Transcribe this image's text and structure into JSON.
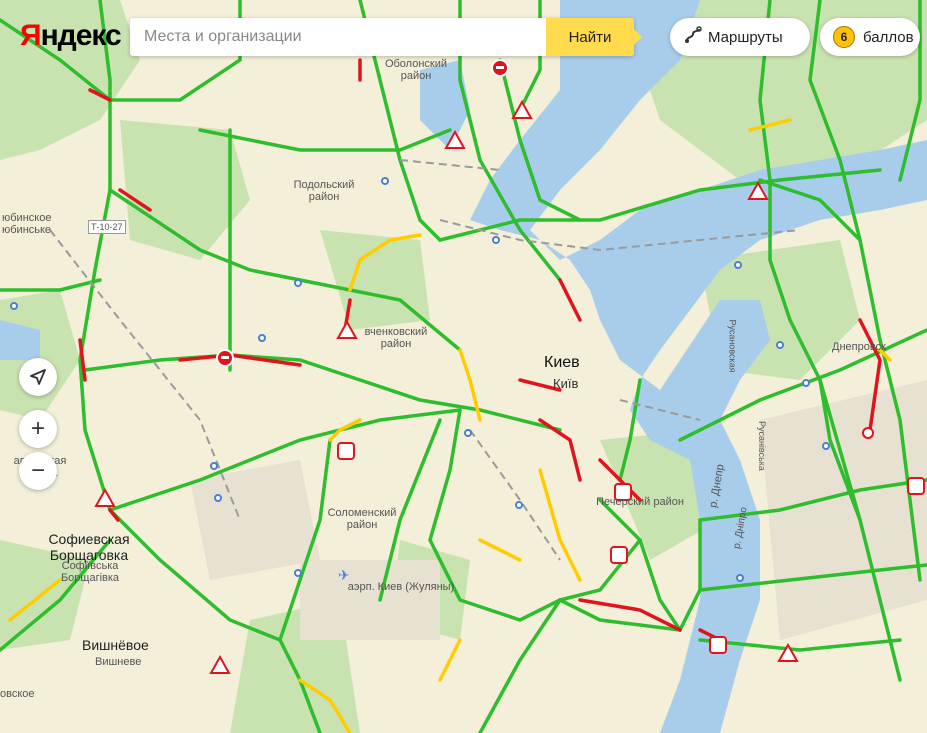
{
  "logo": {
    "part1": "Я",
    "part2": "ндекс"
  },
  "search": {
    "placeholder": "Места и организации",
    "button": "Найти"
  },
  "routes": {
    "label": "Маршруты"
  },
  "points": {
    "count": "6",
    "label": "баллов"
  },
  "controls": {
    "locate": "➤",
    "zoom_in": "+",
    "zoom_out": "−"
  },
  "labels": {
    "obolon": "Оболонский район",
    "podil": "Подольский район",
    "shevchenko": "вченковский район",
    "kyiv_ru": "Киев",
    "kyiv_ua": "Київ",
    "pechersk": "Печерский район",
    "solomyansky": "Соломенский район",
    "airport": "аэрп. Киев (Жуляны)",
    "sofievska": "Софиевская Борщаговка",
    "sofiivska": "Софіївська Борщагівка",
    "vishneve": "Вишнёвое",
    "vyshneve": "Вишневе",
    "lyubinskoe": "юбинское",
    "lyubinske": "юбинське",
    "borshch": "апаевская Борща",
    "boyarka": "овское",
    "dnipro": "Днепровск",
    "rusanovka": "Русановская",
    "dnipr_river": "р. Днепр",
    "dnipro_ua": "р. Дніпро",
    "rusanivska": "Русанівська",
    "road_code": "Т-10-27"
  }
}
